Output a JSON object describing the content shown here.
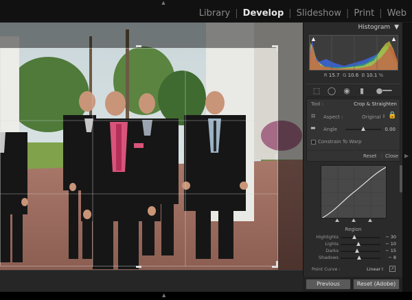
{
  "modules": [
    {
      "label": "Library",
      "active": false
    },
    {
      "label": "Develop",
      "active": true
    },
    {
      "label": "Slideshow",
      "active": false
    },
    {
      "label": "Print",
      "active": false
    },
    {
      "label": "Web",
      "active": false
    }
  ],
  "histogram": {
    "title": "Histogram",
    "readout": {
      "r_label": "R",
      "r": "15.7",
      "g_label": "G",
      "g": "10.6",
      "b_label": "B",
      "b": "10.1",
      "unit": "%"
    }
  },
  "crop": {
    "tool_label": "Tool :",
    "tool_name": "Crop & Straighten",
    "aspect_label": "Aspect :",
    "aspect_value": "Original",
    "angle_label": "Angle",
    "angle_value": "0.00",
    "angle_level": 0.5,
    "constrain_label": "Constrain To Warp",
    "reset_label": "Reset",
    "close_label": "Close"
  },
  "region": {
    "title": "Region",
    "sliders": [
      {
        "label": "Highlights",
        "value": "− 30",
        "level": 0.35
      },
      {
        "label": "Lights",
        "value": "− 10",
        "level": 0.45
      },
      {
        "label": "Darks",
        "value": "− 15",
        "level": 0.42
      },
      {
        "label": "Shadows",
        "value": "− 8",
        "level": 0.46
      }
    ]
  },
  "point_curve": {
    "label": "Point Curve :",
    "value": "Linear"
  },
  "buttons": {
    "previous": "Previous",
    "reset": "Reset (Adobe)"
  },
  "colors": {
    "accent_lock": "#d2a800",
    "panel_bg": "#2a2a2a",
    "background": "#000000"
  },
  "icons": [
    "crop-overlay-icon",
    "spot-removal-icon",
    "red-eye-icon",
    "graduated-filter-icon",
    "adjustment-brush-icon",
    "lock-icon",
    "straighten-icon",
    "point-curve-icon"
  ]
}
